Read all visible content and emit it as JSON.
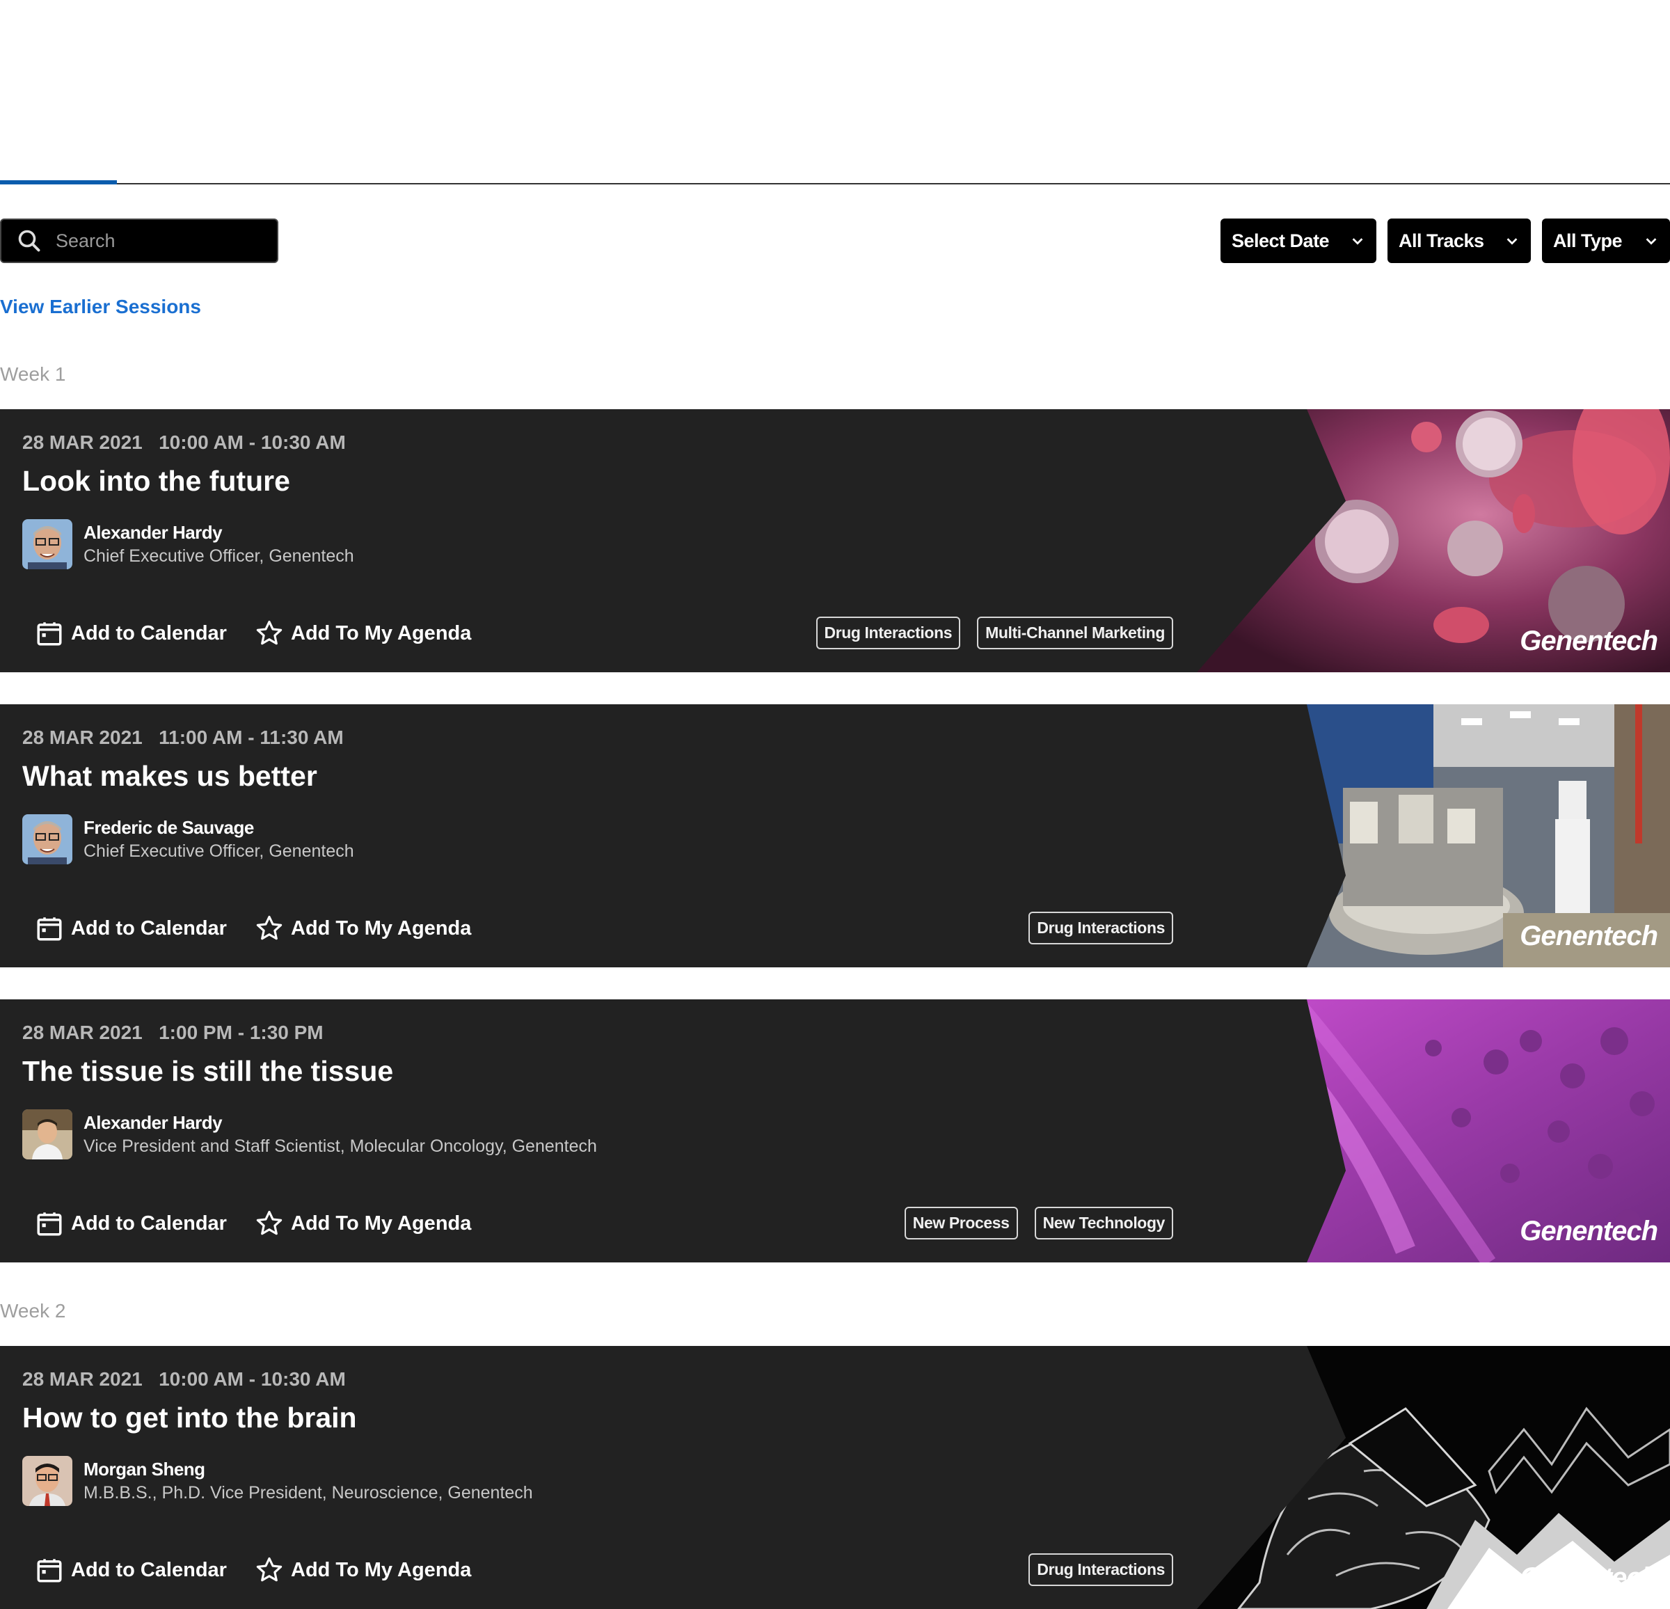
{
  "search": {
    "placeholder": "Search",
    "icon": "search-icon"
  },
  "filters": {
    "date": "Select Date",
    "tracks": "All Tracks",
    "type": "All Type"
  },
  "earlier_link": "View Earlier Sessions",
  "actions": {
    "calendar": "Add to Calendar",
    "agenda": "Add To My Agenda"
  },
  "brand": "Genentech",
  "weeks": [
    "Week 1",
    "Week 2"
  ],
  "sessions": [
    {
      "date": "28 MAR 2021",
      "time": "10:00 AM - 10:30 AM",
      "title": "Look into the future",
      "speaker": "Alexander Hardy",
      "role": "Chief Executive Officer, Genentech",
      "tags": [
        "Drug Interactions",
        "Multi-Channel Marketing"
      ],
      "image": "cells-image"
    },
    {
      "date": "28 MAR 2021",
      "time": "11:00 AM - 11:30 AM",
      "title": "What makes us better",
      "speaker": "Frederic de Sauvage",
      "role": "Chief Executive Officer, Genentech",
      "tags": [
        "Drug Interactions"
      ],
      "image": "lab-image"
    },
    {
      "date": "28 MAR 2021",
      "time": "1:00 PM - 1:30 PM",
      "title": "The tissue is still the tissue",
      "speaker": "Alexander Hardy",
      "role": "Vice President and Staff Scientist, Molecular Oncology, Genentech",
      "tags": [
        "New Process",
        "New Technology"
      ],
      "image": "tissue-image"
    },
    {
      "date": "28 MAR 2021",
      "time": "10:00 AM - 10:30 AM",
      "title": "How to get into the brain",
      "speaker": "Morgan Sheng",
      "role": "M.B.B.S., Ph.D. Vice President, Neuroscience, Genentech",
      "tags": [
        "Drug Interactions"
      ],
      "image": "brain-image"
    }
  ],
  "colors": {
    "accent": "#0b5cad",
    "link": "#1a6fd1",
    "card_bg": "#222222"
  }
}
